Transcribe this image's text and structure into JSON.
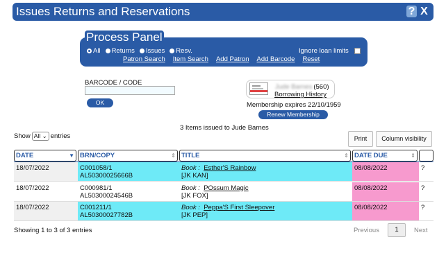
{
  "window": {
    "title": "Issues Returns and Reservations",
    "help_label": "?",
    "close_label": "X"
  },
  "process_panel": {
    "title": "Process Panel",
    "modes": [
      "All",
      "Returns",
      "Issues",
      "Resv."
    ],
    "selected_mode": "All",
    "ignore_loan_limits_label": "Ignore loan limits",
    "links": [
      "Patron Search",
      "Item Search",
      "Add Patron",
      "Add Barcode",
      "Reset"
    ]
  },
  "barcode": {
    "label": "BARCODE / CODE",
    "value": "",
    "ok_label": "OK"
  },
  "patron": {
    "name_blurred": "Jude Barnes",
    "count": "(560)",
    "history_label": "Borrowing History",
    "membership_expires": "Membership expires 22/10/1959",
    "renew_label": "Renew Membership"
  },
  "issued_summary": "3 Items issued to Jude Barnes",
  "table_controls": {
    "show_label": "Show",
    "show_value": "All",
    "entries_label": "entries",
    "print_label": "Print",
    "column_visibility_label": "Column visibility"
  },
  "columns": [
    "DATE",
    "BRN/COPY",
    "TITLE",
    "DATE DUE",
    ""
  ],
  "rows": [
    {
      "date": "18/07/2022",
      "brn": "C001058/1",
      "copy": "AL50300025666B",
      "format": "Book",
      "title": "Esther'S Rainbow",
      "class": "[JK  KAN]",
      "due": "08/08/2022",
      "extra": "?"
    },
    {
      "date": "18/07/2022",
      "brn": "C000981/1",
      "copy": "AL50300024546B",
      "format": "Book",
      "title": "POssum Magic",
      "class": "[JK  FOX]",
      "due": "08/08/2022",
      "extra": "?"
    },
    {
      "date": "18/07/2022",
      "brn": "C001211/1",
      "copy": "AL50300027782B",
      "format": "Book",
      "title": "Peppa'S First Sleepover",
      "class": "[JK  PEP]",
      "due": "08/08/2022",
      "extra": "?"
    }
  ],
  "footer": {
    "showing": "Showing 1 to 3 of 3 entries",
    "previous": "Previous",
    "page": "1",
    "next": "Next"
  }
}
